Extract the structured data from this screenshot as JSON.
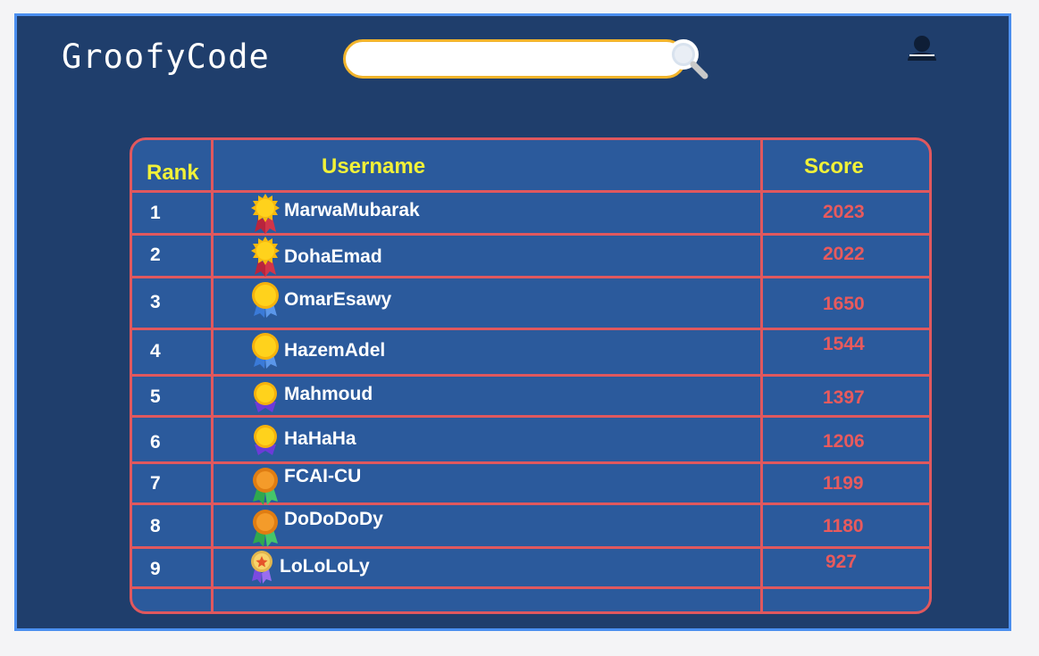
{
  "header": {
    "logo": "GroofyCode",
    "search": {
      "value": "",
      "placeholder": ""
    },
    "search_icon": "magnifier-icon",
    "user_icon": "user-icon"
  },
  "leaderboard": {
    "columns": {
      "rank": "Rank",
      "username": "Username",
      "score": "Score"
    },
    "rows": [
      {
        "rank": "1",
        "username": "MarwaMubarak",
        "score": "2023",
        "medal": "sun-medal-icon"
      },
      {
        "rank": "2",
        "username": "DohaEmad",
        "score": "2022",
        "medal": "sun-medal-icon"
      },
      {
        "rank": "3",
        "username": "OmarEsawy",
        "score": "1650",
        "medal": "gold-medal-icon"
      },
      {
        "rank": "4",
        "username": "HazemAdel",
        "score": "1544",
        "medal": "gold-medal-icon"
      },
      {
        "rank": "5",
        "username": "Mahmoud",
        "score": "1397",
        "medal": "gold-purple-medal-icon"
      },
      {
        "rank": "6",
        "username": "HaHaHa",
        "score": "1206",
        "medal": "gold-purple-medal-icon"
      },
      {
        "rank": "7",
        "username": "FCAI-CU",
        "score": "1199",
        "medal": "bronze-medal-icon"
      },
      {
        "rank": "8",
        "username": "DoDoDoDy",
        "score": "1180",
        "medal": "bronze-medal-icon"
      },
      {
        "rank": "9",
        "username": "LoLoLoLy",
        "score": "927",
        "medal": "star-medal-icon"
      }
    ]
  }
}
